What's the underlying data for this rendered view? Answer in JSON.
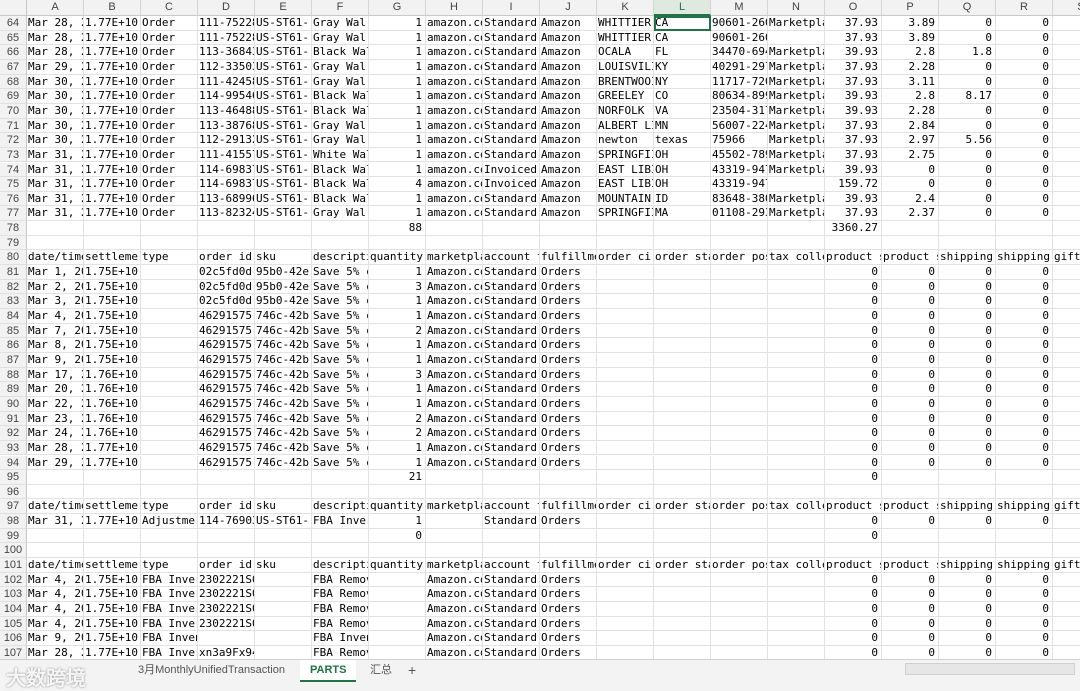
{
  "columns": [
    "A",
    "B",
    "C",
    "D",
    "E",
    "F",
    "G",
    "H",
    "I",
    "J",
    "K",
    "L",
    "M",
    "N",
    "O",
    "P",
    "Q",
    "R",
    "S"
  ],
  "selected_column": "L",
  "active_cell": {
    "row": "64",
    "col": "L"
  },
  "rows": [
    {
      "num": "64",
      "cells": {
        "A": "Mar 28, 2",
        "B": "1.77E+10",
        "C": "Order",
        "D": "111-75228",
        "E": "US-ST61-(",
        "F": "Gray Wal",
        "G": "1",
        "H": "amazon.co",
        "I": "Standard",
        "J": "Amazon",
        "K": "WHITTIER",
        "L": "CA",
        "M": "90601-260",
        "N": "Marketpla",
        "O": "37.93",
        "P": "3.89",
        "Q": "0",
        "R": "0"
      }
    },
    {
      "num": "65",
      "cells": {
        "A": "Mar 28, 2",
        "B": "1.77E+10",
        "C": "Order",
        "D": "111-75228",
        "E": "US-ST61-(",
        "F": "Gray Wal",
        "G": "1",
        "H": "amazon.co",
        "I": "Standard",
        "J": "Amazon",
        "K": "WHITTIER",
        "L": "CA",
        "M": "90601-2602",
        "N": "",
        "O": "37.93",
        "P": "3.89",
        "Q": "0",
        "R": "0"
      }
    },
    {
      "num": "66",
      "cells": {
        "A": "Mar 28, 2",
        "B": "1.77E+10",
        "C": "Order",
        "D": "113-36843",
        "E": "US-ST61-(",
        "F": "Black Wal",
        "G": "1",
        "H": "amazon.co",
        "I": "Standard",
        "J": "Amazon",
        "K": "OCALA",
        "L": "FL",
        "M": "34470-694",
        "N": "Marketpla",
        "O": "39.93",
        "P": "2.8",
        "Q": "1.8",
        "R": "0"
      }
    },
    {
      "num": "67",
      "cells": {
        "A": "Mar 29, 2",
        "B": "1.77E+10",
        "C": "Order",
        "D": "112-33503",
        "E": "US-ST61-(",
        "F": "Gray Wal",
        "G": "1",
        "H": "amazon.co",
        "I": "Standard",
        "J": "Amazon",
        "K": "LOUISVILI",
        "L": "KY",
        "M": "40291-297",
        "N": "Marketpla",
        "O": "37.93",
        "P": "2.28",
        "Q": "0",
        "R": "0"
      }
    },
    {
      "num": "68",
      "cells": {
        "A": "Mar 30, 2",
        "B": "1.77E+10",
        "C": "Order",
        "D": "111-42458",
        "E": "US-ST61-(",
        "F": "Gray Wal",
        "G": "1",
        "H": "amazon.co",
        "I": "Standard",
        "J": "Amazon",
        "K": "BRENTWOOI",
        "L": "NY",
        "M": "11717-720",
        "N": "Marketpla",
        "O": "37.93",
        "P": "3.11",
        "Q": "0",
        "R": "0"
      }
    },
    {
      "num": "69",
      "cells": {
        "A": "Mar 30, 2",
        "B": "1.77E+10",
        "C": "Order",
        "D": "114-99546",
        "E": "US-ST61-(",
        "F": "Black Wal",
        "G": "1",
        "H": "amazon.co",
        "I": "Standard",
        "J": "Amazon",
        "K": "GREELEY",
        "L": "CO",
        "M": "80634-899",
        "N": "Marketpla",
        "O": "39.93",
        "P": "2.8",
        "Q": "8.17",
        "R": "0"
      }
    },
    {
      "num": "70",
      "cells": {
        "A": "Mar 30, 2",
        "B": "1.77E+10",
        "C": "Order",
        "D": "113-46488",
        "E": "US-ST61-(",
        "F": "Black Wal",
        "G": "1",
        "H": "amazon.co",
        "I": "Standard",
        "J": "Amazon",
        "K": "NORFOLK",
        "L": "VA",
        "M": "23504-317",
        "N": "Marketpla",
        "O": "39.93",
        "P": "2.28",
        "Q": "0",
        "R": "0"
      }
    },
    {
      "num": "71",
      "cells": {
        "A": "Mar 30, 2",
        "B": "1.77E+10",
        "C": "Order",
        "D": "113-38768",
        "E": "US-ST61-(",
        "F": "Gray Wal",
        "G": "1",
        "H": "amazon.co",
        "I": "Standard",
        "J": "Amazon",
        "K": "ALBERT LI",
        "L": "MN",
        "M": "56007-224",
        "N": "Marketpla",
        "O": "37.93",
        "P": "2.84",
        "Q": "0",
        "R": "0"
      }
    },
    {
      "num": "72",
      "cells": {
        "A": "Mar 30, 2",
        "B": "1.77E+10",
        "C": "Order",
        "D": "112-29132",
        "E": "US-ST61-(",
        "F": "Gray Wal",
        "G": "1",
        "H": "amazon.co",
        "I": "Standard",
        "J": "Amazon",
        "K": "newton",
        "L": "texas",
        "M": "75966",
        "N": "Marketpla",
        "O": "37.93",
        "P": "2.97",
        "Q": "5.56",
        "R": "0"
      }
    },
    {
      "num": "73",
      "cells": {
        "A": "Mar 31, 2",
        "B": "1.77E+10",
        "C": "Order",
        "D": "111-41557",
        "E": "US-ST61-(",
        "F": "White Wal",
        "G": "1",
        "H": "amazon.co",
        "I": "Standard",
        "J": "Amazon",
        "K": "SPRINGFII",
        "L": "OH",
        "M": "45502-789",
        "N": "Marketpla",
        "O": "37.93",
        "P": "2.75",
        "Q": "0",
        "R": "0"
      }
    },
    {
      "num": "74",
      "cells": {
        "A": "Mar 31, 2",
        "B": "1.77E+10",
        "C": "Order",
        "D": "114-69837",
        "E": "US-ST61-(",
        "F": "Black Wal",
        "G": "1",
        "H": "amazon.co",
        "I": "Invoiced",
        "J": "Amazon",
        "K": "EAST LIBI",
        "L": "OH",
        "M": "43319-947",
        "N": "Marketpla",
        "O": "39.93",
        "P": "0",
        "Q": "0",
        "R": "0"
      }
    },
    {
      "num": "75",
      "cells": {
        "A": "Mar 31, 2",
        "B": "1.77E+10",
        "C": "Order",
        "D": "114-69837",
        "E": "US-ST61-(",
        "F": "Black Wal",
        "G": "4",
        "H": "amazon.co",
        "I": "Invoiced",
        "J": "Amazon",
        "K": "EAST LIBI",
        "L": "OH",
        "M": "43319-9473",
        "N": "",
        "O": "159.72",
        "P": "0",
        "Q": "0",
        "R": "0"
      }
    },
    {
      "num": "76",
      "cells": {
        "A": "Mar 31, 2",
        "B": "1.77E+10",
        "C": "Order",
        "D": "113-68996",
        "E": "US-ST61-(",
        "F": "Black Wal",
        "G": "1",
        "H": "amazon.co",
        "I": "Standard",
        "J": "Amazon",
        "K": "MOUNTAIN",
        "L": "ID",
        "M": "83648-380",
        "N": "Marketpla",
        "O": "39.93",
        "P": "2.4",
        "Q": "0",
        "R": "0"
      }
    },
    {
      "num": "77",
      "cells": {
        "A": "Mar 31, 2",
        "B": "1.77E+10",
        "C": "Order",
        "D": "113-82324",
        "E": "US-ST61-(",
        "F": "Gray Wal",
        "G": "1",
        "H": "amazon.co",
        "I": "Standard",
        "J": "Amazon",
        "K": "SPRINGFII",
        "L": "MA",
        "M": "01108-293",
        "N": "Marketpla",
        "O": "37.93",
        "P": "2.37",
        "Q": "0",
        "R": "0"
      }
    },
    {
      "num": "78",
      "cells": {
        "G": "88",
        "O": "3360.27"
      }
    },
    {
      "num": "79",
      "cells": {}
    },
    {
      "num": "80",
      "cells": {
        "A": "date/time",
        "B": "settlemer",
        "C": "type",
        "D": "order id",
        "E": "sku",
        "F": "descripti",
        "G": "quantity",
        "H": "marketpla",
        "I": "account t",
        "J": "fulfillme",
        "K": "order ci",
        "L": "order sta",
        "M": "order pos",
        "N": "tax colle",
        "O": "product s",
        "P": "product s",
        "Q": "shipping",
        "R": "shipping",
        "S": "gift"
      }
    },
    {
      "num": "81",
      "cells": {
        "A": "Mar 1, 20",
        "B": "1.75E+10",
        "D": "02c5fd0d-",
        "E": "95b0-42e",
        "F": "Save 5% c",
        "G": "1",
        "H": "Amazon.co",
        "I": "Standard",
        "J": "Orders",
        "O": "0",
        "P": "0",
        "Q": "0",
        "R": "0"
      }
    },
    {
      "num": "82",
      "cells": {
        "A": "Mar 2, 20",
        "B": "1.75E+10",
        "D": "02c5fd0d-",
        "E": "95b0-42e",
        "F": "Save 5% c",
        "G": "3",
        "H": "Amazon.co",
        "I": "Standard",
        "J": "Orders",
        "O": "0",
        "P": "0",
        "Q": "0",
        "R": "0"
      }
    },
    {
      "num": "83",
      "cells": {
        "A": "Mar 3, 20",
        "B": "1.75E+10",
        "D": "02c5fd0d-",
        "E": "95b0-42e",
        "F": "Save 5% c",
        "G": "1",
        "H": "Amazon.co",
        "I": "Standard",
        "J": "Orders",
        "O": "0",
        "P": "0",
        "Q": "0",
        "R": "0"
      }
    },
    {
      "num": "84",
      "cells": {
        "A": "Mar 4, 20",
        "B": "1.75E+10",
        "D": "46291575-",
        "E": "746c-42b",
        "F": "Save 5% c",
        "G": "1",
        "H": "Amazon.co",
        "I": "Standard",
        "J": "Orders",
        "O": "0",
        "P": "0",
        "Q": "0",
        "R": "0"
      }
    },
    {
      "num": "85",
      "cells": {
        "A": "Mar 7, 20",
        "B": "1.75E+10",
        "D": "46291575-",
        "E": "746c-42b",
        "F": "Save 5% c",
        "G": "2",
        "H": "Amazon.co",
        "I": "Standard",
        "J": "Orders",
        "O": "0",
        "P": "0",
        "Q": "0",
        "R": "0"
      }
    },
    {
      "num": "86",
      "cells": {
        "A": "Mar 8, 20",
        "B": "1.75E+10",
        "D": "46291575-",
        "E": "746c-42b",
        "F": "Save 5% c",
        "G": "1",
        "H": "Amazon.co",
        "I": "Standard",
        "J": "Orders",
        "O": "0",
        "P": "0",
        "Q": "0",
        "R": "0"
      }
    },
    {
      "num": "87",
      "cells": {
        "A": "Mar 9, 20",
        "B": "1.75E+10",
        "D": "46291575-",
        "E": "746c-42b",
        "F": "Save 5% c",
        "G": "1",
        "H": "Amazon.co",
        "I": "Standard",
        "J": "Orders",
        "O": "0",
        "P": "0",
        "Q": "0",
        "R": "0"
      }
    },
    {
      "num": "88",
      "cells": {
        "A": "Mar 17, 2",
        "B": "1.76E+10",
        "D": "46291575-",
        "E": "746c-42b",
        "F": "Save 5% c",
        "G": "3",
        "H": "Amazon.co",
        "I": "Standard",
        "J": "Orders",
        "O": "0",
        "P": "0",
        "Q": "0",
        "R": "0"
      }
    },
    {
      "num": "89",
      "cells": {
        "A": "Mar 20, 2",
        "B": "1.76E+10",
        "D": "46291575-",
        "E": "746c-42b",
        "F": "Save 5% c",
        "G": "1",
        "H": "Amazon.co",
        "I": "Standard",
        "J": "Orders",
        "O": "0",
        "P": "0",
        "Q": "0",
        "R": "0"
      }
    },
    {
      "num": "90",
      "cells": {
        "A": "Mar 22, 2",
        "B": "1.76E+10",
        "D": "46291575-",
        "E": "746c-42b",
        "F": "Save 5% c",
        "G": "1",
        "H": "Amazon.co",
        "I": "Standard",
        "J": "Orders",
        "O": "0",
        "P": "0",
        "Q": "0",
        "R": "0"
      }
    },
    {
      "num": "91",
      "cells": {
        "A": "Mar 23, 2",
        "B": "1.76E+10",
        "D": "46291575-",
        "E": "746c-42b",
        "F": "Save 5% c",
        "G": "2",
        "H": "Amazon.co",
        "I": "Standard",
        "J": "Orders",
        "O": "0",
        "P": "0",
        "Q": "0",
        "R": "0"
      }
    },
    {
      "num": "92",
      "cells": {
        "A": "Mar 24, 2",
        "B": "1.76E+10",
        "D": "46291575-",
        "E": "746c-42b",
        "F": "Save 5% c",
        "G": "2",
        "H": "Amazon.co",
        "I": "Standard",
        "J": "Orders",
        "O": "0",
        "P": "0",
        "Q": "0",
        "R": "0"
      }
    },
    {
      "num": "93",
      "cells": {
        "A": "Mar 28, 2",
        "B": "1.77E+10",
        "D": "46291575-",
        "E": "746c-42b",
        "F": "Save 5% c",
        "G": "1",
        "H": "Amazon.co",
        "I": "Standard",
        "J": "Orders",
        "O": "0",
        "P": "0",
        "Q": "0",
        "R": "0"
      }
    },
    {
      "num": "94",
      "cells": {
        "A": "Mar 29, 2",
        "B": "1.77E+10",
        "D": "46291575-",
        "E": "746c-42b",
        "F": "Save 5% c",
        "G": "1",
        "H": "Amazon.co",
        "I": "Standard",
        "J": "Orders",
        "O": "0",
        "P": "0",
        "Q": "0",
        "R": "0"
      }
    },
    {
      "num": "95",
      "cells": {
        "G": "21",
        "O": "0"
      }
    },
    {
      "num": "96",
      "cells": {}
    },
    {
      "num": "97",
      "cells": {
        "A": "date/time",
        "B": "settlemer",
        "C": "type",
        "D": "order id",
        "E": "sku",
        "F": "descripti",
        "G": "quantity",
        "H": "marketpla",
        "I": "account t",
        "J": "fulfillme",
        "K": "order ci",
        "L": "order sta",
        "M": "order pos",
        "N": "tax colle",
        "O": "product s",
        "P": "product s",
        "Q": "shipping",
        "R": "shipping",
        "S": "gift"
      }
    },
    {
      "num": "98",
      "cells": {
        "A": "Mar 31, 2",
        "B": "1.77E+10",
        "C": "Adjustmer",
        "D": "114-76903",
        "E": "US-ST61-(",
        "F": "FBA Inver",
        "G": "1",
        "I": "Standard",
        "J": "Orders",
        "O": "0",
        "P": "0",
        "Q": "0",
        "R": "0"
      }
    },
    {
      "num": "99",
      "cells": {
        "G": "0",
        "O": "0"
      }
    },
    {
      "num": "100",
      "cells": {}
    },
    {
      "num": "101",
      "cells": {
        "A": "date/time",
        "B": "settlemer",
        "C": "type",
        "D": "order id",
        "E": "sku",
        "F": "descripti",
        "G": "quantity",
        "H": "marketpla",
        "I": "account t",
        "J": "fulfillme",
        "K": "order ci",
        "L": "order sta",
        "M": "order pos",
        "N": "tax colle",
        "O": "product s",
        "P": "product s",
        "Q": "shipping",
        "R": "shipping",
        "S": "gift"
      }
    },
    {
      "num": "102",
      "cells": {
        "A": "Mar 4, 20",
        "B": "1.75E+10",
        "C": "FBA Inver",
        "D": "2302221S06",
        "F": "FBA Removal Order",
        "H": "Amazon.co",
        "I": "Standard",
        "J": "Orders",
        "O": "0",
        "P": "0",
        "Q": "0",
        "R": "0"
      }
    },
    {
      "num": "103",
      "cells": {
        "A": "Mar 4, 20",
        "B": "1.75E+10",
        "C": "FBA Inver",
        "D": "2302221S06",
        "F": "FBA Removal Order",
        "H": "Amazon.co",
        "I": "Standard",
        "J": "Orders",
        "O": "0",
        "P": "0",
        "Q": "0",
        "R": "0"
      }
    },
    {
      "num": "104",
      "cells": {
        "A": "Mar 4, 20",
        "B": "1.75E+10",
        "C": "FBA Inver",
        "D": "2302221S06",
        "F": "FBA Removal Order",
        "H": "Amazon.co",
        "I": "Standard",
        "J": "Orders",
        "O": "0",
        "P": "0",
        "Q": "0",
        "R": "0"
      }
    },
    {
      "num": "105",
      "cells": {
        "A": "Mar 4, 20",
        "B": "1.75E+10",
        "C": "FBA Inver",
        "D": "2302221S06",
        "F": "FBA Removal Order",
        "H": "Amazon.co",
        "I": "Standard",
        "J": "Orders",
        "O": "0",
        "P": "0",
        "Q": "0",
        "R": "0"
      }
    },
    {
      "num": "106",
      "cells": {
        "A": "Mar 9, 20",
        "B": "1.75E+10",
        "C": "FBA Inventory Fee",
        "F": "FBA Inventory Sto",
        "H": "Amazon.co",
        "I": "Standard",
        "J": "Orders",
        "O": "0",
        "P": "0",
        "Q": "0",
        "R": "0"
      }
    },
    {
      "num": "107",
      "cells": {
        "A": "Mar 28, 2",
        "B": "1.77E+10",
        "C": "FBA Inver",
        "D": "xn3a9Fx944",
        "F": "FBA Removal Order",
        "H": "Amazon.co",
        "I": "Standard",
        "J": "Orders",
        "O": "0",
        "P": "0",
        "Q": "0",
        "R": "0"
      }
    }
  ],
  "numeric_columns": [
    "G",
    "O",
    "P",
    "Q",
    "R"
  ],
  "sheet_tabs": [
    {
      "label": "3月MonthlyUnifiedTransaction",
      "active": false
    },
    {
      "label": "PARTS",
      "active": true
    },
    {
      "label": "汇总",
      "active": false
    }
  ],
  "add_sheet_glyph": "+",
  "watermark": "大数跨境"
}
